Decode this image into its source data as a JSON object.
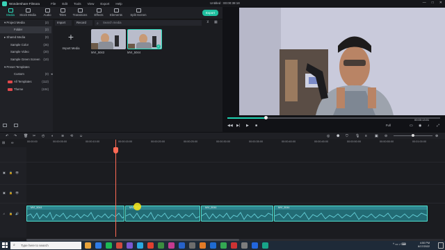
{
  "window": {
    "app_name": "Wondershare Filmora",
    "menu": [
      "File",
      "Edit",
      "Tools",
      "View",
      "Export",
      "Help"
    ],
    "document_title": "Untitled : 00:00:38:18",
    "controls": [
      "—",
      "□",
      "✕"
    ]
  },
  "top_tabs": [
    {
      "label": "Media",
      "active": true
    },
    {
      "label": "Stock Media",
      "active": false
    },
    {
      "label": "Audio",
      "active": false
    },
    {
      "label": "Titles",
      "active": false
    },
    {
      "label": "Transitions",
      "active": false
    },
    {
      "label": "Effects",
      "active": false
    },
    {
      "label": "Elements",
      "active": false
    },
    {
      "label": "Split Screen",
      "active": false
    }
  ],
  "export_label": "Export",
  "sidebar": {
    "items": [
      {
        "label": "▾ Project Media",
        "count": "(2)"
      },
      {
        "label": "Folder",
        "count": "(2)",
        "selected": true
      },
      {
        "label": "▸ Shared Media",
        "count": "(0)"
      },
      {
        "label": "Sample Color",
        "count": "(25)"
      },
      {
        "label": "Sample Video",
        "count": "(20)"
      },
      {
        "label": "Sample Green Screen",
        "count": "(10)"
      },
      {
        "label": "▾ Preset Templates",
        "count": ""
      },
      {
        "label": "Custom",
        "count": "(0)"
      },
      {
        "label": "All Templates",
        "count": "(112)",
        "tag": true
      },
      {
        "label": "Theme",
        "count": "(104)",
        "tag": true
      }
    ]
  },
  "media_panel": {
    "import_dropdown": "Import",
    "record_dropdown": "Record",
    "search_placeholder": "Search media",
    "import_tile_label": "Import Media",
    "import_plus": "+",
    "items": [
      {
        "name": "MVI_5043"
      },
      {
        "name": "MVI_5044",
        "checked": true
      }
    ]
  },
  "preview": {
    "timecode": "00:00:13:01",
    "quality": "Full",
    "transport": [
      "◀◀",
      "▶|",
      "▶",
      "■"
    ]
  },
  "timeline": {
    "ruler_labels": [
      "00:00:00",
      "00:00:05:00",
      "00:00:10:00",
      "00:00:15:00",
      "00:00:20:00",
      "00:00:25:00",
      "00:00:30:00",
      "00:00:35:00",
      "00:00:40:00",
      "00:00:45:00",
      "00:00:50:00",
      "00:00:55:00",
      "00:01:00:00"
    ],
    "clips": [
      {
        "label": "MVI_5044"
      },
      {
        "label": "MVI_5044"
      },
      {
        "label": "MVI_5044"
      },
      {
        "label": "MVI_5044"
      }
    ]
  },
  "taskbar": {
    "search_placeholder": "Type here to search",
    "time": "4:50 PM",
    "date": "8/17/2022",
    "colors": [
      "#e8a33a",
      "#2f7be5",
      "#1db954",
      "#d04a3c",
      "#7a57d1",
      "#2aa8e0",
      "#e0402f",
      "#3c8d3f",
      "#c43a8f",
      "#2762c9",
      "#6d6d6d",
      "#e07b27",
      "#1f6bd1",
      "#34a853",
      "#cc3333",
      "#7d7d7d",
      "#2266dd",
      "#17a589"
    ]
  }
}
